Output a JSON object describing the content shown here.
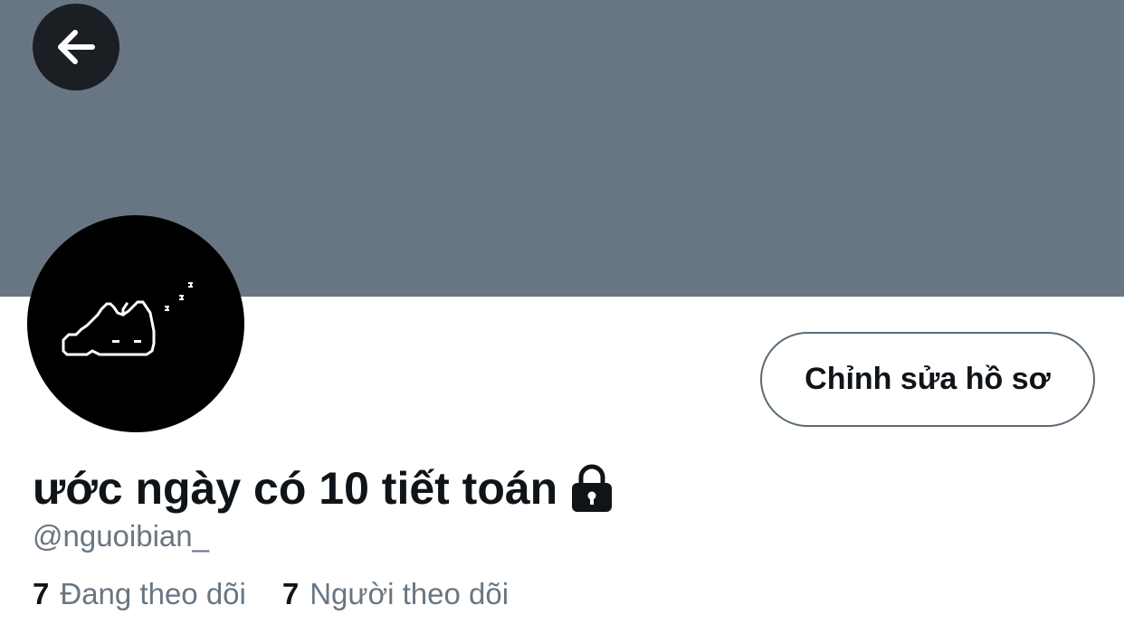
{
  "colors": {
    "banner": "#687684",
    "secondary_text": "#687684",
    "primary_text": "#0f1419",
    "back_button_bg": "#1b1f23"
  },
  "header": {
    "back_icon": "arrow-left-icon"
  },
  "profile": {
    "avatar_icon": "sleeping-cat-pixel-art",
    "edit_button_label": "Chỉnh sửa hồ sơ",
    "display_name": "ước ngày có 10 tiết toán",
    "lock_icon": "lock-icon",
    "handle": "@nguoibian_",
    "stats": {
      "following_count": "7",
      "following_label": "Đang theo dõi",
      "followers_count": "7",
      "followers_label": "Người theo dõi"
    }
  }
}
